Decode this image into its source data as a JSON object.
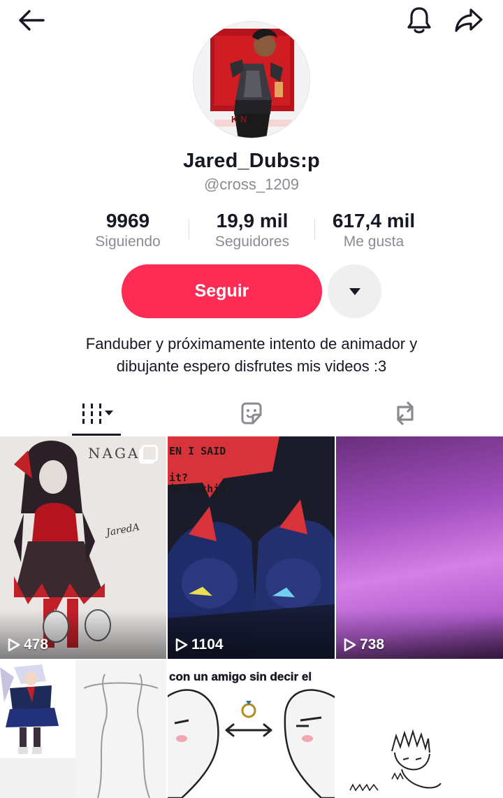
{
  "header": {
    "back_icon": "arrow-left-icon",
    "notifications_icon": "bell-icon",
    "share_icon": "share-arrow-icon"
  },
  "profile": {
    "display_name": "Jared_Dubs:p",
    "username": "@cross_1209",
    "avatar_text": "K    N",
    "stats": [
      {
        "value": "9969",
        "label": "Siguiendo"
      },
      {
        "value": "19,9 mil",
        "label": "Seguidores"
      },
      {
        "value": "617,4 mil",
        "label": "Me gusta"
      }
    ],
    "follow_label": "Seguir",
    "bio_line1": "Fanduber y próximamente intento de animador y",
    "bio_line2": "dibujante espero disfrutes mis videos :3"
  },
  "tabs": [
    {
      "icon": "grid-videos-icon",
      "active": true
    },
    {
      "icon": "sticker-favorites-icon",
      "active": false
    },
    {
      "icon": "repost-icon",
      "active": false
    }
  ],
  "videos": [
    {
      "views": "478",
      "overlay": "NAGA",
      "signature": "JaredA"
    },
    {
      "views": "1104",
      "overlay_line1": "EN I SAID",
      "overlay_line2": "it?",
      "overlay_line3": "id nothin-"
    },
    {
      "views": "738"
    },
    {},
    {
      "overlay": "con un amigo sin decir el"
    },
    {}
  ],
  "colors": {
    "accent": "#fe2c55",
    "text": "#161823",
    "secondary": "#8a8b91"
  }
}
